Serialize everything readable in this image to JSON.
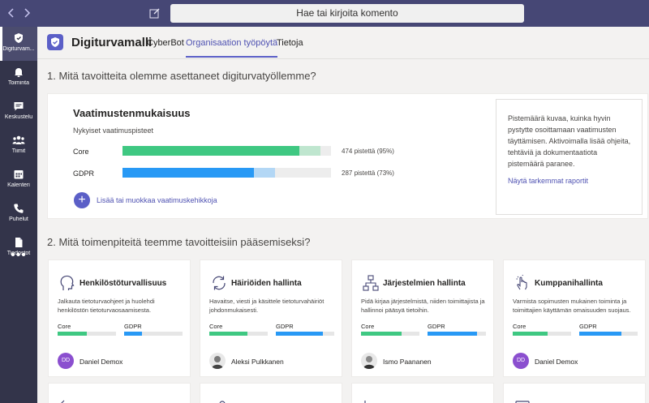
{
  "topbar": {
    "back_icon": "chevron-left-icon",
    "forward_icon": "chevron-right-icon",
    "compose_icon": "compose-icon",
    "search_placeholder": "Hae tai kirjoita komento"
  },
  "rail": {
    "items": [
      {
        "label": "Digiturvam...",
        "icon": "shield-app-icon",
        "active": true
      },
      {
        "label": "Toiminta",
        "icon": "bell-icon"
      },
      {
        "label": "Keskustelu",
        "icon": "chat-icon"
      },
      {
        "label": "Tiimit",
        "icon": "teams-icon"
      },
      {
        "label": "Kalenteri",
        "icon": "calendar-icon"
      },
      {
        "label": "Puhelut",
        "icon": "phone-icon"
      },
      {
        "label": "Tiedostot",
        "icon": "files-icon"
      }
    ],
    "more": "•••"
  },
  "app": {
    "name": "Digiturvamalli",
    "tabs": [
      "CyberBot",
      "Organisaation työpöytä",
      "Tietoja"
    ],
    "active_tab": 1
  },
  "section1": {
    "question": "1. Mitä tavoitteita olemme asettaneet digiturvatyöllemme?",
    "title": "Vaatimustenmukaisuus",
    "subtitle": "Nykyiset vaatimuspisteet",
    "bars": [
      {
        "name": "Core",
        "percent": 95,
        "base_percent": 85,
        "score_text": "474 pistettä (95%)",
        "color": "#3fc882",
        "light_color": "#bfe6cf"
      },
      {
        "name": "GDPR",
        "percent": 73,
        "base_percent": 63,
        "score_text": "287 pistettä (73%)",
        "color": "#2899f5",
        "light_color": "#b3d7f5"
      }
    ],
    "add_label": "Lisää tai muokkaa vaatimuskehikkoja",
    "info_text": "Pistemäärä kuvaa, kuinka hyvin pystytte osoittamaan vaatimusten täyttämisen. Aktivoimalla lisää ohjeita, tehtäviä ja dokumentaatiota pistemäärä paranee.",
    "report_link": "Näytä tarkemmat raportit"
  },
  "section2": {
    "question": "2. Mitä toimenpiteitä teemme tavoitteisiin pääsemiseksi?",
    "cards": [
      {
        "title": "Henkilöstöturvallisuus",
        "icon": "person-head-icon",
        "desc": "Jalkauta tietoturvaohjeet ja huolehdi henkilöstön tietoturvaosaamisesta.",
        "core_label": "Core",
        "gdpr_label": "GDPR",
        "core_fill": 0.5,
        "gdpr_fill": 0.3,
        "owner": "Daniel Demox",
        "initials": "DD",
        "photo": false
      },
      {
        "title": "Häiriöiden hallinta",
        "icon": "refresh-icon",
        "desc": "Havaitse, viesti ja käsittele tietoturvahäiriöt johdonmukaisesti.",
        "core_label": "Core",
        "gdpr_label": "GDPR",
        "core_fill": 0.65,
        "gdpr_fill": 0.8,
        "owner": "Aleksi Pulkkanen",
        "initials": "",
        "photo": true
      },
      {
        "title": "Järjestelmien hallinta",
        "icon": "hierarchy-icon",
        "desc": "Pidä kirjaa järjestelmistä, niiden toimittajista ja hallinnoi pääsyä tietoihin.",
        "core_label": "Core",
        "gdpr_label": "GDPR",
        "core_fill": 0.7,
        "gdpr_fill": 0.85,
        "owner": "Ismo Paananen",
        "initials": "",
        "photo": true
      },
      {
        "title": "Kumppanihallinta",
        "icon": "touch-hand-icon",
        "desc": "Varmista sopimusten mukainen toiminta ja toimittajien käyttämän omaisuuden suojaus.",
        "core_label": "Core",
        "gdpr_label": "GDPR",
        "core_fill": 0.6,
        "gdpr_fill": 0.72,
        "owner": "Daniel Demox",
        "initials": "DD",
        "photo": false
      }
    ]
  },
  "colors": {
    "teams_purple": "#464775",
    "accent": "#5b5fc7",
    "core_green": "#3fc882",
    "gdpr_blue": "#2899f5",
    "avatar_purple": "#8b4fcf"
  }
}
